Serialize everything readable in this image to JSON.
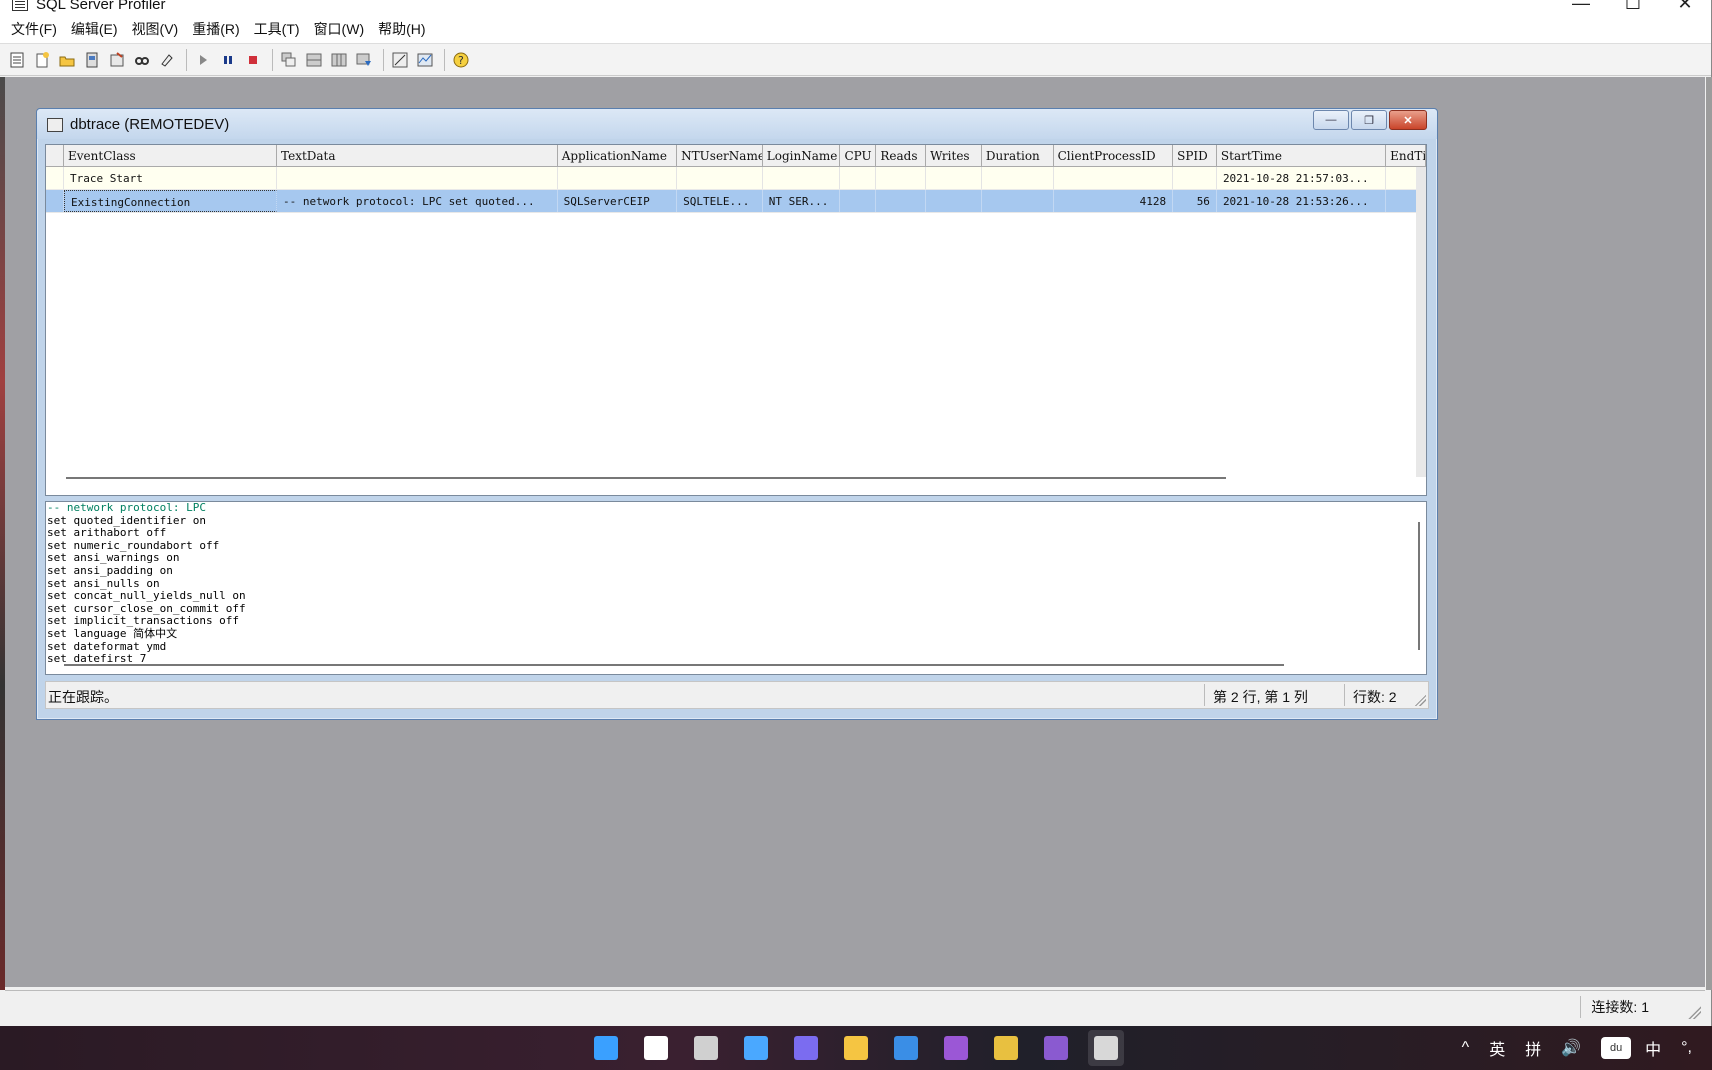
{
  "app": {
    "title": "SQL Server Profiler",
    "menu": [
      "文件(F)",
      "编辑(E)",
      "视图(V)",
      "重播(R)",
      "工具(T)",
      "窗口(W)",
      "帮助(H)"
    ],
    "status_connections": "连接数: 1",
    "window_controls": {
      "minimize": "—",
      "maximize": "☐",
      "close": "✕"
    }
  },
  "toolbar_icons": [
    "properties-icon",
    "new-trace-icon",
    "open-icon",
    "template-icon",
    "save-icon",
    "find-icon",
    "clear-icon",
    "run-icon",
    "pause-icon",
    "stop-icon",
    "cascade-icon",
    "tile-icon",
    "columns-icon",
    "filter-icon",
    "auto-scroll-icon",
    "monitor-icon",
    "help-icon"
  ],
  "child": {
    "title": "dbtrace (REMOTEDEV)",
    "controls": {
      "minimize": "—",
      "restore": "❐",
      "close": "✕"
    },
    "columns": [
      "EventClass",
      "TextData",
      "ApplicationName",
      "NTUserName",
      "LoginName",
      "CPU",
      "Reads",
      "Writes",
      "Duration",
      "ClientProcessID",
      "SPID",
      "StartTime",
      "EndTi"
    ],
    "rows": [
      {
        "EventClass": "Trace Start",
        "TextData": "",
        "ApplicationName": "",
        "NTUserName": "",
        "LoginName": "",
        "CPU": "",
        "Reads": "",
        "Writes": "",
        "Duration": "",
        "ClientProcessID": "",
        "SPID": "",
        "StartTime": "2021-10-28 21:57:03...",
        "EndTime": ""
      },
      {
        "EventClass": "ExistingConnection",
        "TextData": "-- network protocol: LPC  set quoted...",
        "ApplicationName": "SQLServerCEIP",
        "NTUserName": "SQLTELE...",
        "LoginName": "NT SER...",
        "CPU": "",
        "Reads": "",
        "Writes": "",
        "Duration": "",
        "ClientProcessID": "4128",
        "SPID": "56",
        "StartTime": "2021-10-28 21:53:26...",
        "EndTime": ""
      }
    ],
    "selected_row": 1,
    "detail_lines": [
      "-- network protocol: LPC",
      "set quoted_identifier on",
      "set arithabort off",
      "set numeric_roundabort off",
      "set ansi_warnings on",
      "set ansi_padding on",
      "set ansi_nulls on",
      "set concat_null_yields_null on",
      "set cursor_close_on_commit off",
      "set implicit_transactions off",
      "set language 简体中文",
      "set dateformat ymd",
      "set datefirst 7"
    ],
    "status": {
      "message": "正在跟踪。",
      "position": "第 2 行, 第 1 列",
      "rows": "行数: 2"
    }
  },
  "taskbar": {
    "apps": [
      {
        "icon": "start-icon",
        "color": "#3aa0ff"
      },
      {
        "icon": "search-icon",
        "color": "#ffffff"
      },
      {
        "icon": "task-view-icon",
        "color": "#d0d0d0"
      },
      {
        "icon": "widgets-icon",
        "color": "#4aa8ff"
      },
      {
        "icon": "chat-icon",
        "color": "#7b6cf0"
      },
      {
        "icon": "file-explorer-icon",
        "color": "#f5c542"
      },
      {
        "icon": "store-icon",
        "color": "#3a8ee6"
      },
      {
        "icon": "visual-studio-preview-icon",
        "color": "#9b57d6"
      },
      {
        "icon": "tool-icon",
        "color": "#e8c040"
      },
      {
        "icon": "visual-studio-icon",
        "color": "#8a5ad0"
      },
      {
        "icon": "sql-profiler-icon",
        "color": "#d8d8d8"
      }
    ],
    "tray": [
      "^",
      "英",
      "拼",
      "🔊"
    ],
    "ime": "du",
    "ime_mode": "中",
    "ime_punct": "°,"
  }
}
